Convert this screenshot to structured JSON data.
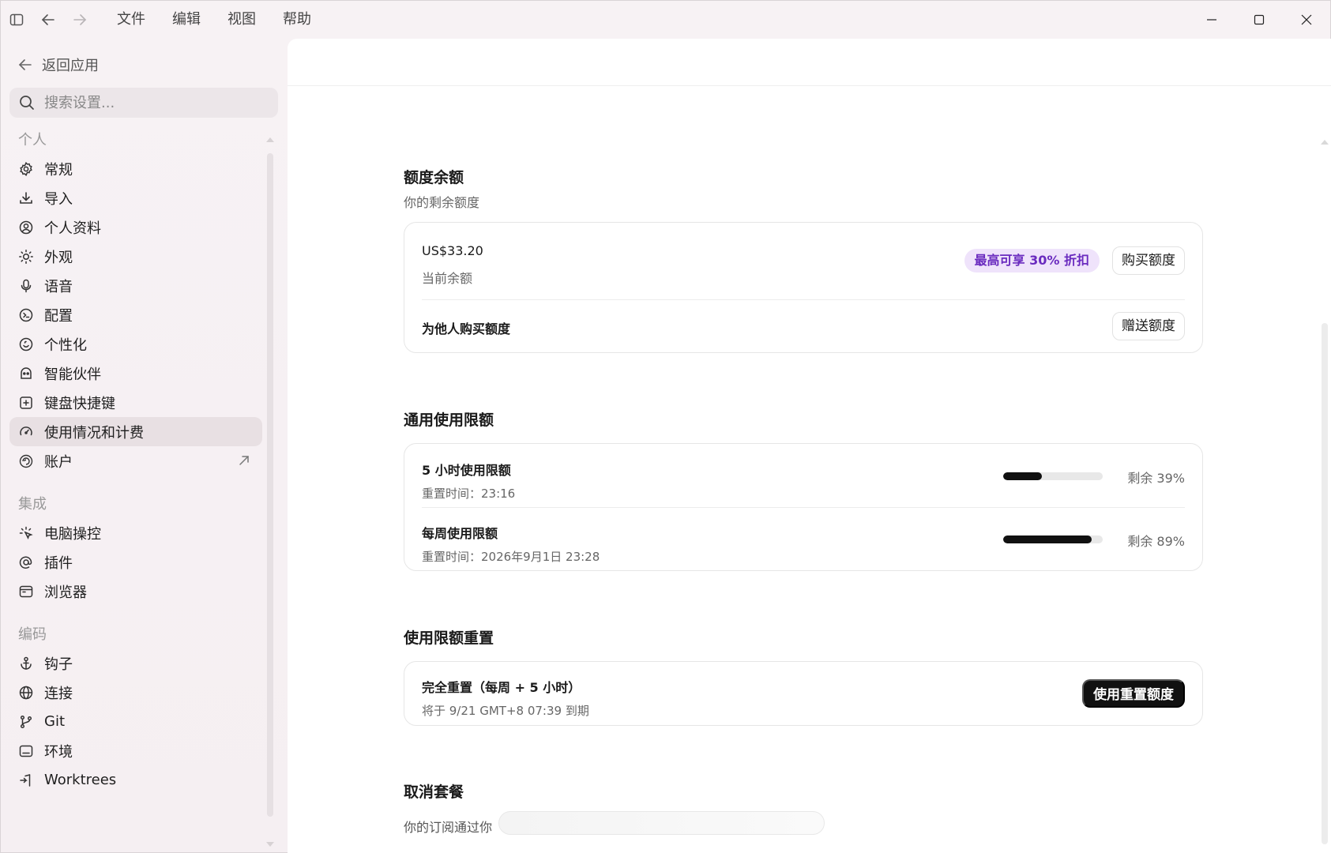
{
  "menu": [
    "文件",
    "编辑",
    "视图",
    "帮助"
  ],
  "sidebar": {
    "back_label": "返回应用",
    "search_placeholder": "搜索设置...",
    "sections": [
      {
        "title": "个人",
        "items": [
          {
            "label": "常规",
            "icon": "gear-icon"
          },
          {
            "label": "导入",
            "icon": "download-icon"
          },
          {
            "label": "个人资料",
            "icon": "profile-icon"
          },
          {
            "label": "外观",
            "icon": "sun-icon"
          },
          {
            "label": "语音",
            "icon": "mic-icon"
          },
          {
            "label": "配置",
            "icon": "config-icon"
          },
          {
            "label": "个性化",
            "icon": "smile-icon"
          },
          {
            "label": "智能伙伴",
            "icon": "agent-icon"
          },
          {
            "label": "键盘快捷键",
            "icon": "keyboard-icon"
          },
          {
            "label": "使用情况和计费",
            "icon": "gauge-icon",
            "active": true
          },
          {
            "label": "账户",
            "icon": "account-icon",
            "external": true
          }
        ]
      },
      {
        "title": "集成",
        "items": [
          {
            "label": "电脑操控",
            "icon": "computer-control-icon"
          },
          {
            "label": "插件",
            "icon": "at-icon"
          },
          {
            "label": "浏览器",
            "icon": "browser-icon"
          }
        ]
      },
      {
        "title": "编码",
        "items": [
          {
            "label": "钩子",
            "icon": "anchor-icon"
          },
          {
            "label": "连接",
            "icon": "globe-icon"
          },
          {
            "label": "Git",
            "icon": "git-branch-icon"
          },
          {
            "label": "环境",
            "icon": "terminal-icon"
          },
          {
            "label": "Worktrees",
            "icon": "worktree-icon"
          }
        ]
      }
    ]
  },
  "credits": {
    "title": "额度余额",
    "subtitle": "你的剩余额度",
    "balance": "US$33.20",
    "balance_label": "当前余额",
    "discount_badge": "最高可享 30% 折扣",
    "buy_button": "购买额度",
    "gift_label": "为他人购买额度",
    "gift_button": "赠送额度"
  },
  "limits": {
    "title": "通用使用限额",
    "items": [
      {
        "name": "5 小时使用限额",
        "reset": "重置时间：23:16",
        "remaining_pct": 39,
        "remaining_text": "剩余 39%"
      },
      {
        "name": "每周使用限额",
        "reset": "重置时间：2026年9月1日 23:28",
        "remaining_pct": 89,
        "remaining_text": "剩余 89%"
      }
    ]
  },
  "reset": {
    "title": "使用限额重置",
    "item_title": "完全重置（每周 + 5 小时）",
    "item_sub": "将于 9/21 GMT+8 07:39 到期",
    "button": "使用重置额度"
  },
  "cancel": {
    "title": "取消套餐",
    "text": "你的订阅通过你"
  },
  "colors": {
    "accent_badge_bg": "#efe3fb",
    "accent_badge_text": "#6a2bbf",
    "progress_fill": "#111111"
  }
}
